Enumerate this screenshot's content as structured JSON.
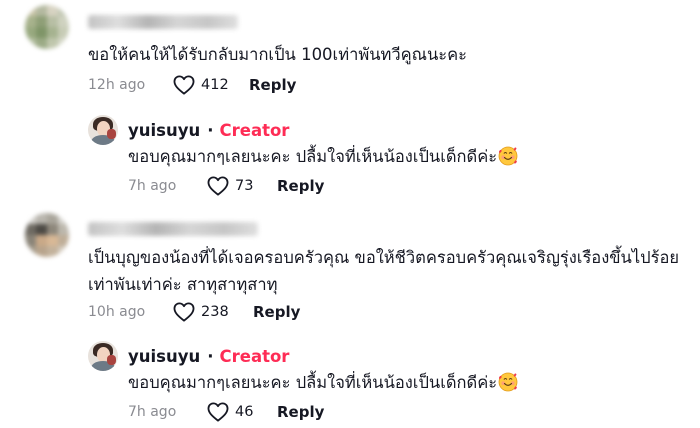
{
  "comments": [
    {
      "text": "ขอให้คนให้ได้รับกลับมากเป็น 100เท่าพันทวีคูณนะคะ",
      "time": "12h ago",
      "likes": "412",
      "reply_label": "Reply",
      "reply": {
        "username": "yuisuyu",
        "separator": "·",
        "badge": "Creator",
        "text": "ขอบคุณมากๆเลยนะคะ ปลื้มใจที่เห็นน้องเป็นเด็กดีค่ะ",
        "time": "7h ago",
        "likes": "73",
        "reply_label": "Reply"
      }
    },
    {
      "text_line1": "เป็นบุญของน้องที่ได้เจอครอบครัวคุณ ขอให้ชีวิตครอบครัวคุณเจริญรุ่งเรืองขึ้นไปร้อย",
      "text_line2": "เท่าพันเท่าค่ะ สาทุสาทุสาทุ",
      "time": "10h ago",
      "likes": "238",
      "reply_label": "Reply",
      "reply": {
        "username": "yuisuyu",
        "separator": "·",
        "badge": "Creator",
        "text": "ขอบคุณมากๆเลยนะคะ ปลื้มใจที่เห็นน้องเป็นเด็กดีค่ะ",
        "time": "7h ago",
        "likes": "46",
        "reply_label": "Reply"
      }
    }
  ],
  "colors": {
    "creator_badge": "#fe2c55",
    "meta_gray": "#8a8b91",
    "text": "#161823"
  },
  "icons": {
    "like": "heart-outline-icon",
    "emoji": "smiling-face-with-hearts-emoji"
  }
}
